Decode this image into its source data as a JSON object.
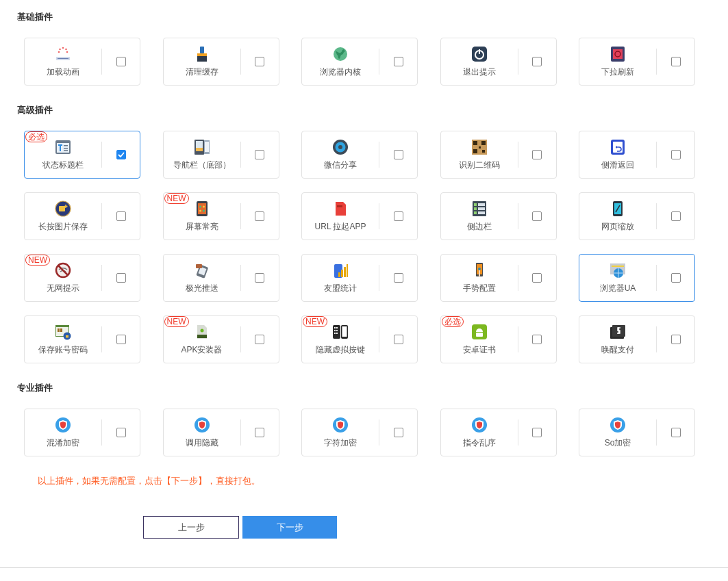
{
  "sections": [
    {
      "title": "基础插件",
      "plugins": [
        {
          "label": "加载动画",
          "checked": false,
          "highlighted": false
        },
        {
          "label": "清理缓存",
          "checked": false,
          "highlighted": false
        },
        {
          "label": "浏览器内核",
          "checked": false,
          "highlighted": false
        },
        {
          "label": "退出提示",
          "checked": false,
          "highlighted": false
        },
        {
          "label": "下拉刷新",
          "checked": false,
          "highlighted": false
        }
      ]
    },
    {
      "title": "高级插件",
      "plugins": [
        {
          "label": "状态标题栏",
          "checked": true,
          "highlighted": true,
          "badge": "必选"
        },
        {
          "label": "导航栏（底部）",
          "checked": false,
          "highlighted": false
        },
        {
          "label": "微信分享",
          "checked": false,
          "highlighted": false
        },
        {
          "label": "识别二维码",
          "checked": false,
          "highlighted": false
        },
        {
          "label": "侧滑返回",
          "checked": false,
          "highlighted": false
        },
        {
          "label": "长按图片保存",
          "checked": false,
          "highlighted": false
        },
        {
          "label": "屏幕常亮",
          "checked": false,
          "highlighted": false,
          "badge": "NEW"
        },
        {
          "label": "URL 拉起APP",
          "checked": false,
          "highlighted": false
        },
        {
          "label": "侧边栏",
          "checked": false,
          "highlighted": false
        },
        {
          "label": "网页缩放",
          "checked": false,
          "highlighted": false
        },
        {
          "label": "无网提示",
          "checked": false,
          "highlighted": false,
          "badge": "NEW"
        },
        {
          "label": "极光推送",
          "checked": false,
          "highlighted": false
        },
        {
          "label": "友盟统计",
          "checked": false,
          "highlighted": false
        },
        {
          "label": "手势配置",
          "checked": false,
          "highlighted": false
        },
        {
          "label": "浏览器UA",
          "checked": false,
          "highlighted": true
        },
        {
          "label": "保存账号密码",
          "checked": false,
          "highlighted": false
        },
        {
          "label": "APK安装器",
          "checked": false,
          "highlighted": false,
          "badge": "NEW"
        },
        {
          "label": "隐藏虚拟按键",
          "checked": false,
          "highlighted": false,
          "badge": "NEW"
        },
        {
          "label": "安卓证书",
          "checked": false,
          "highlighted": false,
          "badge": "必选"
        },
        {
          "label": "唤醒支付",
          "checked": false,
          "highlighted": false
        }
      ]
    },
    {
      "title": "专业插件",
      "plugins": [
        {
          "label": "混淆加密",
          "checked": false,
          "highlighted": false
        },
        {
          "label": "调用隐藏",
          "checked": false,
          "highlighted": false
        },
        {
          "label": "字符加密",
          "checked": false,
          "highlighted": false
        },
        {
          "label": "指令乱序",
          "checked": false,
          "highlighted": false
        },
        {
          "label": "So加密",
          "checked": false,
          "highlighted": false
        }
      ]
    }
  ],
  "tip": "以上插件，如果无需配置，点击【下一步】，直接打包。",
  "buttons": {
    "prev": "上一步",
    "next": "下一步"
  }
}
